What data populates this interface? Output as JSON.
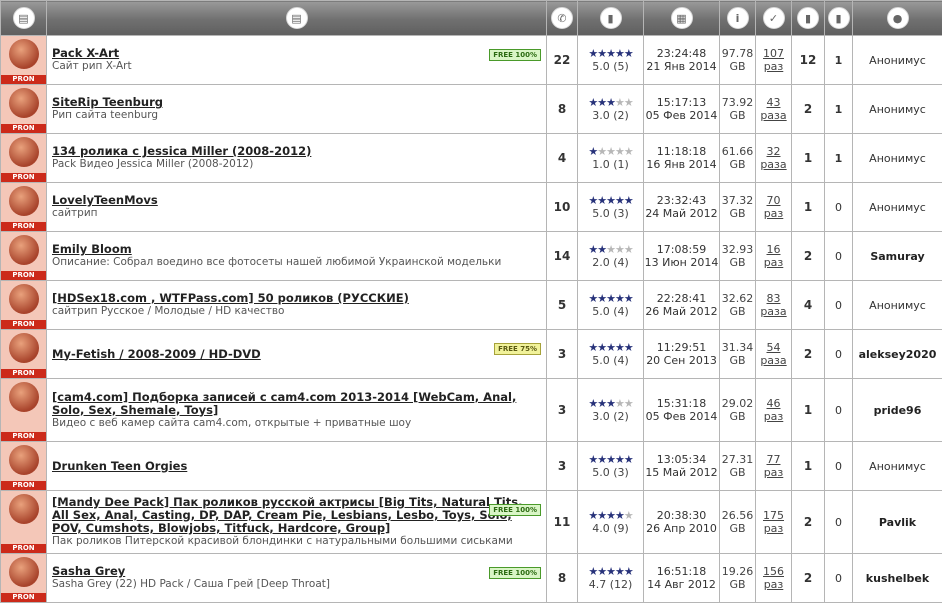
{
  "columns": [
    {
      "icon": "folder-icon"
    },
    {
      "icon": "document-icon"
    },
    {
      "icon": "comments-icon"
    },
    {
      "icon": "rating-icon"
    },
    {
      "icon": "calendar-icon"
    },
    {
      "icon": "size-info-icon"
    },
    {
      "icon": "downloads-icon"
    },
    {
      "icon": "seeders-icon"
    },
    {
      "icon": "leechers-icon"
    },
    {
      "icon": "uploader-icon"
    }
  ],
  "header_glyphs": [
    "▤",
    "▤",
    "✆",
    "▮",
    "▦",
    "i",
    "✓",
    "▮",
    "▮",
    "●"
  ],
  "category_label": "PRON",
  "free_labels": {
    "full": "FREE 100%",
    "partial": "FREE 75%"
  },
  "rows": [
    {
      "title": "Pack X-Art",
      "desc": "Сайт рип X-Art",
      "free": "full",
      "comments": "22",
      "stars": 5,
      "score": "5.0 (5)",
      "time": "23:24:48",
      "date": "21 Янв 2014",
      "size_val": "97.78",
      "size_unit": "GB",
      "dl_num": "107",
      "dl_unit": "раз",
      "seeds": "12",
      "leech": "1",
      "user": "Анонимус",
      "user_bold": false
    },
    {
      "title": "SiteRip Teenburg",
      "desc": "Рип сайта teenburg",
      "free": "",
      "comments": "8",
      "stars": 3,
      "score": "3.0 (2)",
      "time": "15:17:13",
      "date": "05 Фев 2014",
      "size_val": "73.92",
      "size_unit": "GB",
      "dl_num": "43",
      "dl_unit": "раза",
      "seeds": "2",
      "leech": "1",
      "user": "Анонимус",
      "user_bold": false
    },
    {
      "title": "134 ролика с Jessica Miller (2008-2012)",
      "desc": "Pack Видео Jessica Miller (2008-2012)",
      "free": "",
      "comments": "4",
      "stars": 1,
      "score": "1.0 (1)",
      "time": "11:18:18",
      "date": "16 Янв 2014",
      "size_val": "61.66",
      "size_unit": "GB",
      "dl_num": "32",
      "dl_unit": "раза",
      "seeds": "1",
      "leech": "1",
      "user": "Анонимус",
      "user_bold": false
    },
    {
      "title": "LovelyTeenMovs",
      "desc": "сайтрип",
      "free": "",
      "comments": "10",
      "stars": 5,
      "score": "5.0 (3)",
      "time": "23:32:43",
      "date": "24 Май 2012",
      "size_val": "37.32",
      "size_unit": "GB",
      "dl_num": "70",
      "dl_unit": "раз",
      "seeds": "1",
      "leech": "0",
      "user": "Анонимус",
      "user_bold": false
    },
    {
      "title": "Emily Bloom",
      "desc": "Описание: Собрал воедино все фотосеты нашей любимой Украинской модельки",
      "free": "",
      "comments": "14",
      "stars": 2,
      "score": "2.0 (4)",
      "time": "17:08:59",
      "date": "13 Июн 2014",
      "size_val": "32.93",
      "size_unit": "GB",
      "dl_num": "16",
      "dl_unit": "раз",
      "seeds": "2",
      "leech": "0",
      "user": "Samuray",
      "user_bold": true
    },
    {
      "title": "[HDSex18.com , WTFPass.com] 50 роликов (РУССКИЕ)",
      "desc": "сайтрип Русское / Молодые / HD качество",
      "free": "",
      "comments": "5",
      "stars": 5,
      "score": "5.0 (4)",
      "time": "22:28:41",
      "date": "26 Май 2012",
      "size_val": "32.62",
      "size_unit": "GB",
      "dl_num": "83",
      "dl_unit": "раза",
      "seeds": "4",
      "leech": "0",
      "user": "Анонимус",
      "user_bold": false
    },
    {
      "title": "My-Fetish / 2008-2009 / HD-DVD",
      "desc": "",
      "free": "partial",
      "comments": "3",
      "stars": 5,
      "score": "5.0 (4)",
      "time": "11:29:51",
      "date": "20 Сен 2013",
      "size_val": "31.34",
      "size_unit": "GB",
      "dl_num": "54",
      "dl_unit": "раза",
      "seeds": "2",
      "leech": "0",
      "user": "aleksey2020",
      "user_bold": true
    },
    {
      "title": "[cam4.com] Подборка записей с cam4.com 2013-2014 [WebCam, Anal, Solo, Sex, Shemale, Toys]",
      "desc": "Видео с веб камер сайта cam4.com, открытые + приватные шоу",
      "free": "",
      "comments": "3",
      "stars": 3,
      "score": "3.0 (2)",
      "time": "15:31:18",
      "date": "05 Фев 2014",
      "size_val": "29.02",
      "size_unit": "GB",
      "dl_num": "46",
      "dl_unit": "раз",
      "seeds": "1",
      "leech": "0",
      "user": "pride96",
      "user_bold": true
    },
    {
      "title": "Drunken Teen Orgies",
      "desc": "",
      "free": "",
      "comments": "3",
      "stars": 5,
      "score": "5.0 (3)",
      "time": "13:05:34",
      "date": "15 Май 2012",
      "size_val": "27.31",
      "size_unit": "GB",
      "dl_num": "77",
      "dl_unit": "раз",
      "seeds": "1",
      "leech": "0",
      "user": "Анонимус",
      "user_bold": false
    },
    {
      "title": "[Mandy Dee Pack] Пак роликов русской актрисы [Big Tits, Natural Tits, All Sex, Anal, Casting, DP, DAP, Cream Pie, Lesbians, Lesbo, Toys, Solo, POV, Cumshots, Blowjobs, Titfuck, Hardcore, Group]",
      "desc": "Пак роликов Питерской красивой блондинки с натуральными большими сиськами",
      "free": "full",
      "comments": "11",
      "stars": 4,
      "score": "4.0 (9)",
      "time": "20:38:30",
      "date": "26 Апр 2010",
      "size_val": "26.56",
      "size_unit": "GB",
      "dl_num": "175",
      "dl_unit": "раз",
      "seeds": "2",
      "leech": "0",
      "user": "Pavlik",
      "user_bold": true
    },
    {
      "title": "Sasha Grey",
      "desc": "Sasha Grey (22) HD Pack / Саша Грей [Deep Throat]",
      "free": "full",
      "comments": "8",
      "stars": 4.7,
      "score": "4.7 (12)",
      "time": "16:51:18",
      "date": "14 Авг 2012",
      "size_val": "19.26",
      "size_unit": "GB",
      "dl_num": "156",
      "dl_unit": "раз",
      "seeds": "2",
      "leech": "0",
      "user": "kushelbek",
      "user_bold": true
    }
  ]
}
